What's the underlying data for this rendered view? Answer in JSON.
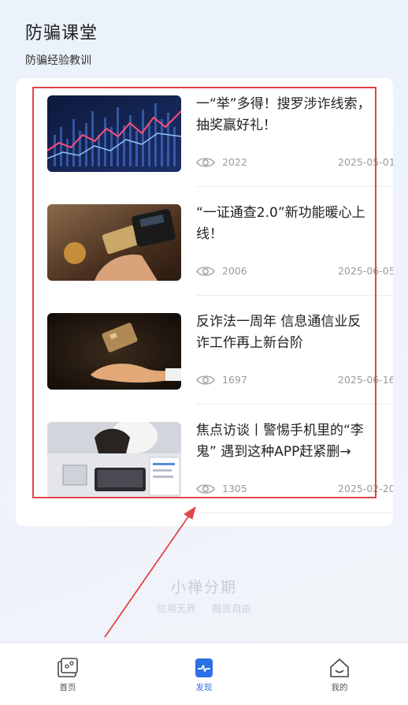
{
  "header": {
    "title": "防骗课堂",
    "subtitle": "防骗经验教训"
  },
  "articles": [
    {
      "title_line1": "一“举”多得！搜罗涉诈线索，",
      "title_line2": "抽奖赢好礼！",
      "views": "2022",
      "date": "2025-05-01",
      "thumb": "stock-chart-image"
    },
    {
      "title_line1": "“一证通查2.0”新功能暖心上",
      "title_line2": "线！",
      "views": "2006",
      "date": "2025-06-05",
      "thumb": "card-payment-image"
    },
    {
      "title_line1": "反诈法一周年 信息通信业反",
      "title_line2": "诈工作再上新台阶",
      "views": "1697",
      "date": "2025-06-16",
      "thumb": "floating-card-hand-image"
    },
    {
      "title_line1": "焦点访谈丨警惕手机里的“李",
      "title_line2": "鬼” 遇到这种APP赶紧删→",
      "views": "1305",
      "date": "2025-02-20",
      "thumb": "laptop-desk-image"
    }
  ],
  "brand": {
    "name": "小禅分期",
    "slogan1": "信用无界",
    "slogan2": "融资自由"
  },
  "tabbar": [
    {
      "label": "首页",
      "icon": "home-card-icon",
      "active": false
    },
    {
      "label": "发现",
      "icon": "discover-icon",
      "active": true
    },
    {
      "label": "我的",
      "icon": "profile-house-icon",
      "active": false
    }
  ],
  "colors": {
    "accent": "#2f6fe6",
    "highlight": "#e0454a"
  }
}
